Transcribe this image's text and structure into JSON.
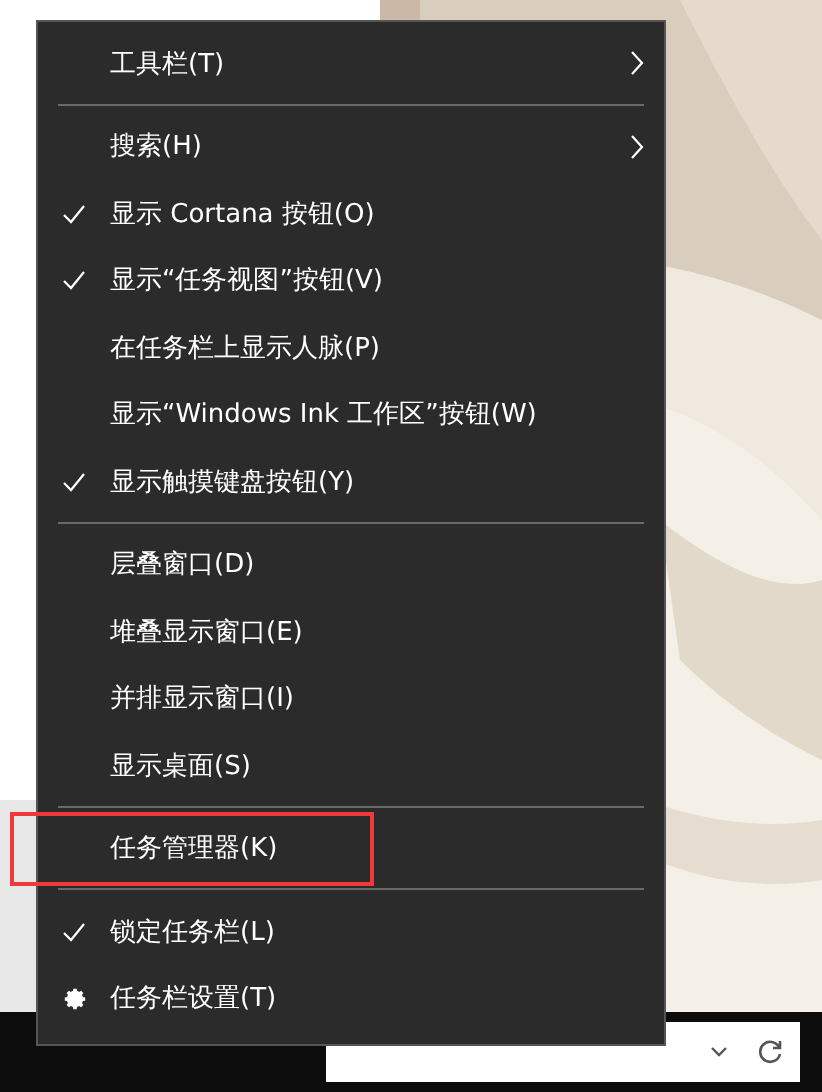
{
  "menu": {
    "items": [
      {
        "kind": "item",
        "label": "工具栏(T)",
        "checked": false,
        "submenu": true,
        "annotated": false
      },
      {
        "kind": "separator"
      },
      {
        "kind": "item",
        "label": "搜索(H)",
        "checked": false,
        "submenu": true,
        "annotated": false
      },
      {
        "kind": "item",
        "label": "显示 Cortana 按钮(O)",
        "checked": true,
        "submenu": false,
        "annotated": false
      },
      {
        "kind": "item",
        "label": "显示“任务视图”按钮(V)",
        "checked": true,
        "submenu": false,
        "annotated": false
      },
      {
        "kind": "item",
        "label": "在任务栏上显示人脉(P)",
        "checked": false,
        "submenu": false,
        "annotated": false
      },
      {
        "kind": "item",
        "label": "显示“Windows Ink 工作区”按钮(W)",
        "checked": false,
        "submenu": false,
        "annotated": false
      },
      {
        "kind": "item",
        "label": "显示触摸键盘按钮(Y)",
        "checked": true,
        "submenu": false,
        "annotated": false
      },
      {
        "kind": "separator"
      },
      {
        "kind": "item",
        "label": "层叠窗口(D)",
        "checked": false,
        "submenu": false,
        "annotated": false
      },
      {
        "kind": "item",
        "label": "堆叠显示窗口(E)",
        "checked": false,
        "submenu": false,
        "annotated": false
      },
      {
        "kind": "item",
        "label": "并排显示窗口(I)",
        "checked": false,
        "submenu": false,
        "annotated": false
      },
      {
        "kind": "item",
        "label": "显示桌面(S)",
        "checked": false,
        "submenu": false,
        "annotated": false
      },
      {
        "kind": "separator"
      },
      {
        "kind": "item",
        "label": "任务管理器(K)",
        "checked": false,
        "submenu": false,
        "annotated": true
      },
      {
        "kind": "separator"
      },
      {
        "kind": "item",
        "label": "锁定任务栏(L)",
        "checked": true,
        "submenu": false,
        "annotated": false
      },
      {
        "kind": "gear",
        "label": "任务栏设置(T)",
        "checked": false,
        "submenu": false,
        "annotated": false
      }
    ]
  }
}
